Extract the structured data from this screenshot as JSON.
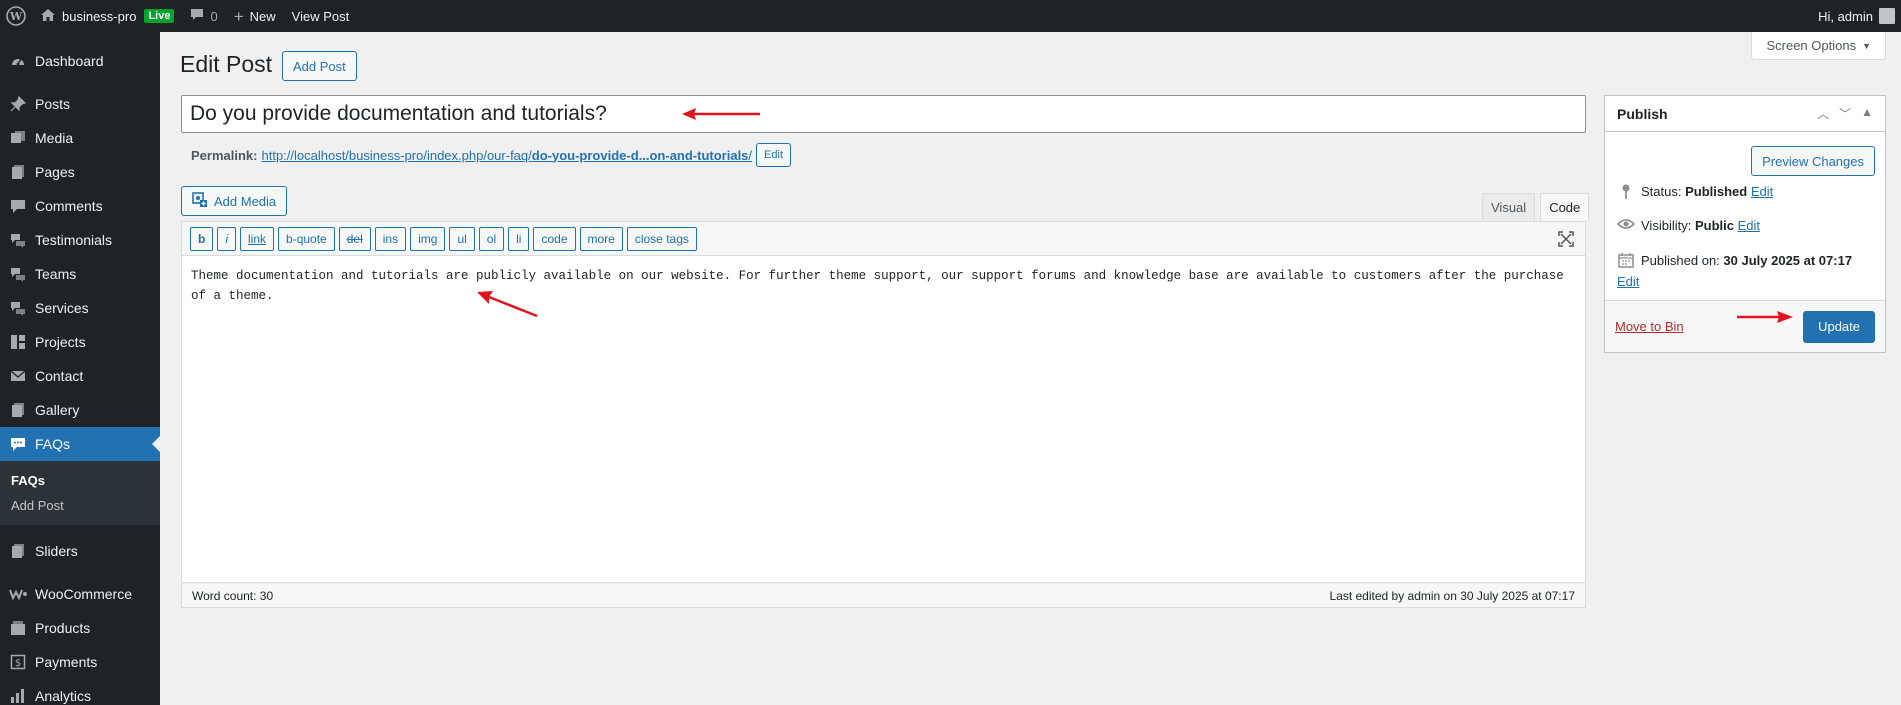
{
  "adminbar": {
    "site_name": "business-pro",
    "live_badge": "Live",
    "comments_count": "0",
    "new_label": "New",
    "view_post": "View Post",
    "greeting": "Hi, admin"
  },
  "sidebar": {
    "items": [
      {
        "label": "Dashboard",
        "icon": "dashboard-icon"
      },
      {
        "label": "Posts",
        "icon": "pin-icon"
      },
      {
        "label": "Media",
        "icon": "media-icon"
      },
      {
        "label": "Pages",
        "icon": "pages-icon"
      },
      {
        "label": "Comments",
        "icon": "comments-icon"
      },
      {
        "label": "Testimonials",
        "icon": "testimonials-icon"
      },
      {
        "label": "Teams",
        "icon": "teams-icon"
      },
      {
        "label": "Services",
        "icon": "services-icon"
      },
      {
        "label": "Projects",
        "icon": "projects-icon"
      },
      {
        "label": "Contact",
        "icon": "contact-icon"
      },
      {
        "label": "Gallery",
        "icon": "gallery-icon"
      },
      {
        "label": "FAQs",
        "icon": "faqs-icon"
      },
      {
        "label": "Sliders",
        "icon": "sliders-icon"
      },
      {
        "label": "WooCommerce",
        "icon": "woocommerce-icon"
      },
      {
        "label": "Products",
        "icon": "products-icon"
      },
      {
        "label": "Payments",
        "icon": "payments-icon"
      },
      {
        "label": "Analytics",
        "icon": "analytics-icon"
      }
    ],
    "submenu": [
      "FAQs",
      "Add Post"
    ]
  },
  "main": {
    "screen_options": "Screen Options",
    "page_title": "Edit Post",
    "add_post": "Add Post",
    "post_title": "Do you provide documentation and tutorials?",
    "permalink_label": "Permalink:",
    "permalink_base": "http://localhost/business-pro/index.php/our-faq/",
    "permalink_slug": "do-you-provide-d...on-and-tutorials",
    "permalink_trail": "/",
    "permalink_edit": "Edit",
    "add_media": "Add Media",
    "tab_visual": "Visual",
    "tab_code": "Code",
    "toolbar": [
      "b",
      "i",
      "link",
      "b-quote",
      "del",
      "ins",
      "img",
      "ul",
      "ol",
      "li",
      "code",
      "more",
      "close tags"
    ],
    "content": "Theme documentation and tutorials are publicly available on our website. For further theme support, our support forums and knowledge base are available to customers after the purchase of a theme.",
    "word_count": "Word count: 30",
    "last_edited": "Last edited by admin on 30 July 2025 at 07:17"
  },
  "publish": {
    "title": "Publish",
    "preview_changes": "Preview Changes",
    "status_label": "Status:",
    "status_value": "Published",
    "visibility_label": "Visibility:",
    "visibility_value": "Public",
    "published_label": "Published on:",
    "published_value": "30 July 2025 at 07:17",
    "edit": "Edit",
    "move_to_bin": "Move to Bin",
    "update": "Update"
  },
  "colors": {
    "accent": "#2271b1",
    "admin_bg": "#1d2327",
    "live": "#00a32a",
    "danger": "#b32d2e",
    "arrow": "#e0141e"
  }
}
